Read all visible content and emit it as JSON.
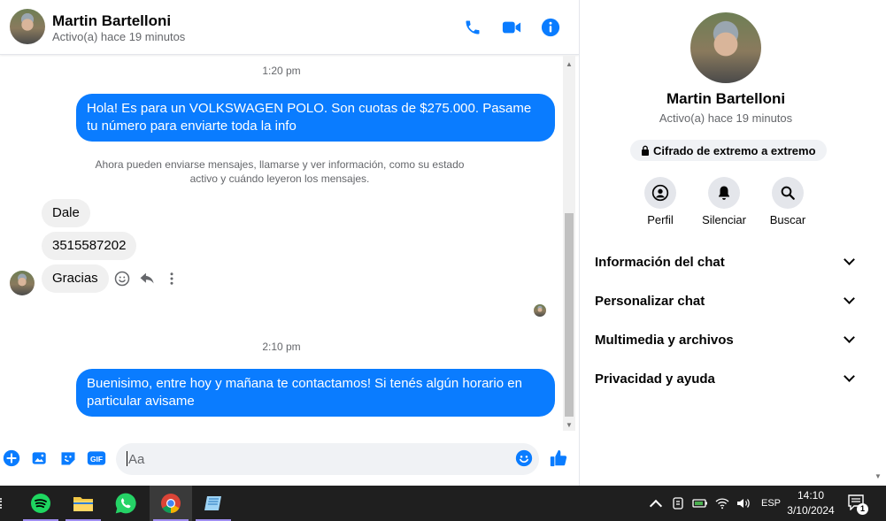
{
  "header": {
    "name": "Martin Bartelloni",
    "status": "Activo(a) hace 19 minutos"
  },
  "messages": {
    "time1": "1:20 pm",
    "out1": "Hola! Es para un VOLKSWAGEN POLO. Son cuotas de $275.000. Pasame tu número para enviarte toda la info",
    "notice_line1": "Ahora pueden enviarse mensajes, llamarse y ver información, como su estado",
    "notice_line2": "activo y cuándo leyeron los mensajes.",
    "in1": "Dale",
    "in2": "3515587202",
    "in3": "Gracias",
    "time2": "2:10 pm",
    "out2": "Buenisimo, entre hoy y mañana te contactamos! Si tenés algún horario en particular avisame"
  },
  "composer": {
    "placeholder": "Aa"
  },
  "panel": {
    "name": "Martin Bartelloni",
    "status": "Activo(a) hace 19 minutos",
    "encryption": "Cifrado de extremo a extremo",
    "actions": [
      {
        "label": "Perfil",
        "icon": "profile-icon"
      },
      {
        "label": "Silenciar",
        "icon": "bell-icon"
      },
      {
        "label": "Buscar",
        "icon": "search-icon"
      }
    ],
    "sections": [
      {
        "label": "Información del chat"
      },
      {
        "label": "Personalizar chat"
      },
      {
        "label": "Multimedia y archivos"
      },
      {
        "label": "Privacidad y ayuda"
      }
    ]
  },
  "taskbar": {
    "apps": [
      "spotify-icon",
      "file-explorer-icon",
      "whatsapp-icon",
      "chrome-icon",
      "notes-icon"
    ],
    "language": "ESP",
    "time": "14:10",
    "date": "3/10/2024",
    "notification_count": "1"
  },
  "colors": {
    "accent": "#0a7cff",
    "incoming_bubble": "#f0f0f0",
    "taskbar": "#1f1f1f"
  }
}
